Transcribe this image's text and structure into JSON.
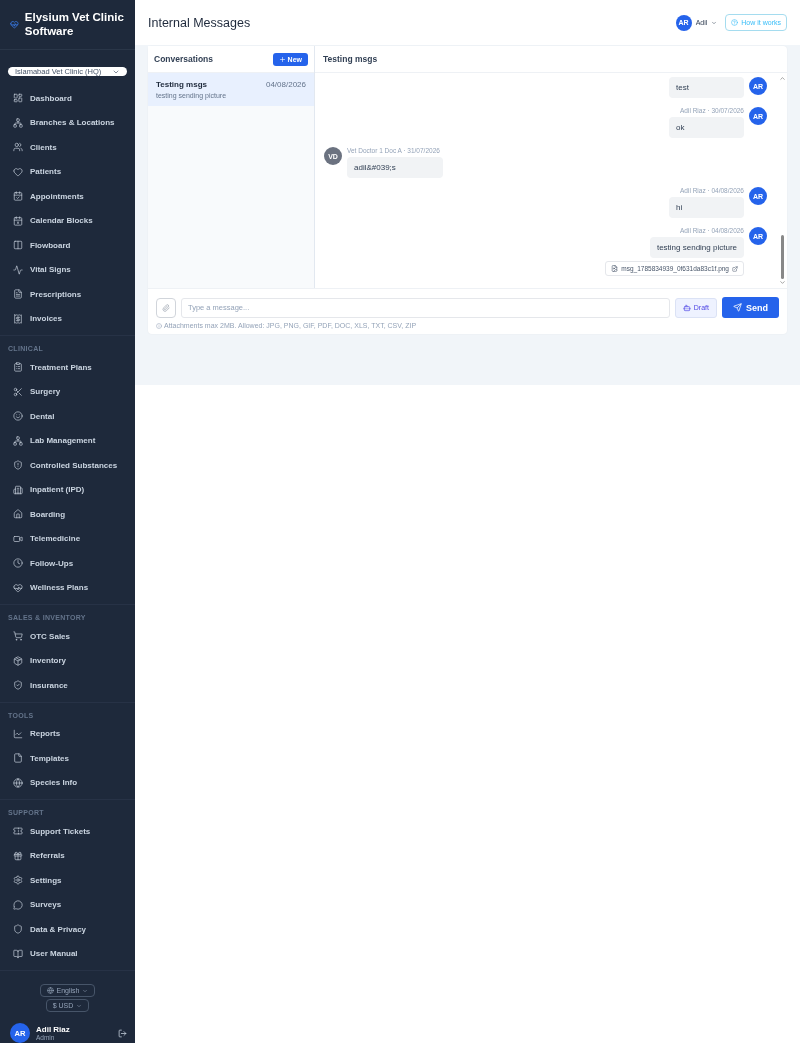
{
  "app": {
    "name": "Elysium Vet Clinic Software"
  },
  "clinic_select": {
    "value": "Islamabad Vet Clinic (HQ)"
  },
  "nav_sections": [
    {
      "items": [
        {
          "label": "Dashboard",
          "selected": false
        },
        {
          "label": "Branches & Locations",
          "selected": false
        },
        {
          "label": "Clients",
          "selected": false
        },
        {
          "label": "Patients",
          "selected": false
        },
        {
          "label": "Appointments",
          "selected": false
        },
        {
          "label": "Calendar Blocks",
          "selected": false
        },
        {
          "label": "Flowboard",
          "selected": false
        },
        {
          "label": "Vital Signs",
          "selected": false
        },
        {
          "label": "Prescriptions",
          "selected": false
        },
        {
          "label": "Invoices",
          "selected": false
        }
      ]
    },
    {
      "title": "CLINICAL",
      "items": [
        {
          "label": "Treatment Plans",
          "selected": false
        },
        {
          "label": "Surgery",
          "selected": false
        },
        {
          "label": "Dental",
          "selected": false
        },
        {
          "label": "Lab Management",
          "selected": false
        },
        {
          "label": "Controlled Substances",
          "selected": false
        },
        {
          "label": "Inpatient (IPD)",
          "selected": false
        },
        {
          "label": "Boarding",
          "selected": false
        },
        {
          "label": "Telemedicine",
          "selected": false
        },
        {
          "label": "Follow-Ups",
          "selected": false
        },
        {
          "label": "Wellness Plans",
          "selected": false
        }
      ]
    },
    {
      "title": "SALES & INVENTORY",
      "items": [
        {
          "label": "OTC Sales",
          "selected": false
        },
        {
          "label": "Inventory",
          "selected": false
        },
        {
          "label": "Insurance",
          "selected": false
        }
      ]
    },
    {
      "title": "TOOLS",
      "items": [
        {
          "label": "Reports",
          "selected": false
        },
        {
          "label": "Templates",
          "selected": false
        },
        {
          "label": "Species Info",
          "selected": false
        }
      ]
    },
    {
      "title": "SUPPORT",
      "items": [
        {
          "label": "Support Tickets",
          "selected": false
        },
        {
          "label": "Referrals",
          "selected": false
        },
        {
          "label": "Settings",
          "selected": false
        },
        {
          "label": "Surveys",
          "selected": false
        },
        {
          "label": "Data & Privacy",
          "selected": false
        },
        {
          "label": "User Manual",
          "selected": false
        }
      ]
    }
  ],
  "sidebar_footer": {
    "language": "English",
    "currency_symbol": "$",
    "currency": "USD",
    "user": {
      "initials": "AR",
      "name": "Adil Riaz",
      "role": "Admin"
    }
  },
  "header": {
    "title": "Internal Messages",
    "user": {
      "initials": "AR",
      "name": "Adil"
    },
    "help_button": "How it works"
  },
  "conversations": {
    "title": "Conversations",
    "new_button": "New",
    "items": [
      {
        "title": "Testing msgs",
        "date": "04/08/2026",
        "preview": "testing sending picture",
        "selected": true
      }
    ]
  },
  "chat": {
    "title": "Testing msgs",
    "messages": [
      {
        "kind": "outgoing",
        "initials": "AR",
        "text": "test"
      },
      {
        "kind": "outgoing",
        "initials": "AR",
        "meta": "Adil Riaz · 30/07/2026",
        "text": "ok"
      },
      {
        "kind": "incoming",
        "initials": "VD",
        "meta": "Vet Doctor 1 Doc A · 31/07/2026",
        "text": "adil&#039;s"
      },
      {
        "kind": "outgoing",
        "initials": "AR",
        "meta": "Adil Riaz · 04/08/2026",
        "text": "hi"
      },
      {
        "kind": "outgoing",
        "initials": "AR",
        "meta": "Adil Riaz · 04/08/2026",
        "text": "testing sending picture",
        "attachment": "msg_1785834939_0f631da83c1f.png"
      }
    ]
  },
  "composer": {
    "placeholder": "Type a message...",
    "draft_button": "Draft",
    "send_button": "Send",
    "hint": "Attachments max 2MB. Allowed: JPG, PNG, GIF, PDF, DOC, XLS, TXT, CSV, ZIP"
  }
}
